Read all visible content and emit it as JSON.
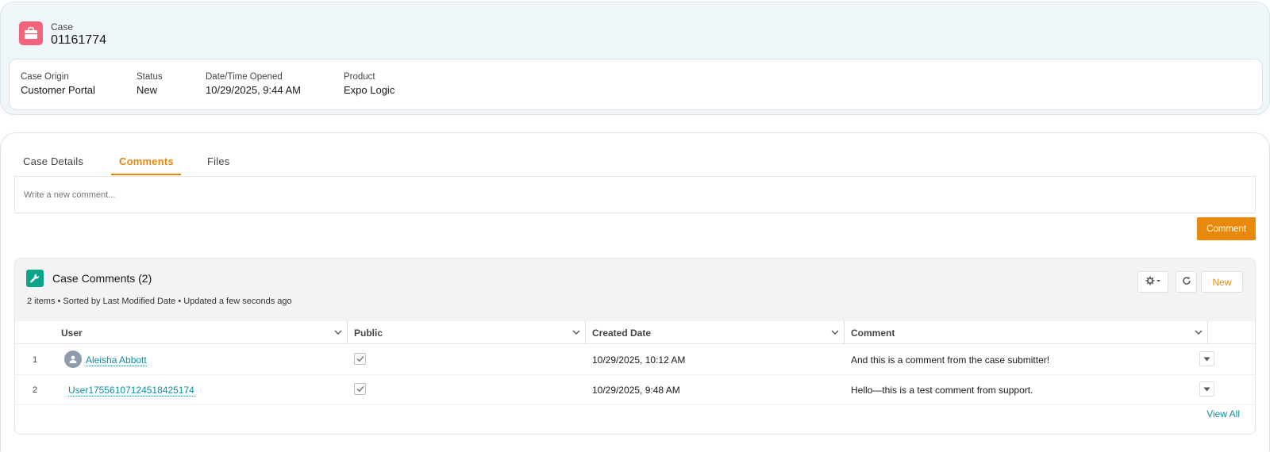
{
  "header": {
    "object_label": "Case",
    "case_number": "01161774",
    "fields": [
      {
        "label": "Case Origin",
        "value": "Customer Portal"
      },
      {
        "label": "Status",
        "value": "New"
      },
      {
        "label": "Date/Time Opened",
        "value": "10/29/2025, 9:44 AM"
      },
      {
        "label": "Product",
        "value": "Expo Logic"
      }
    ],
    "icon": "briefcase-icon",
    "icon_color": "#f2637c"
  },
  "tabs": [
    {
      "label": "Case Details"
    },
    {
      "label": "Comments",
      "active": true
    },
    {
      "label": "Files"
    }
  ],
  "composer": {
    "placeholder": "Write a new comment...",
    "submit_label": "Comment",
    "accent": "#e8890c"
  },
  "related_list": {
    "title": "Case Comments (2)",
    "meta": "2 items • Sorted by Last Modified Date • Updated a few seconds ago",
    "new_label": "New",
    "icon": "wrench-icon",
    "icon_color": "#0aa48a",
    "columns": [
      "User",
      "Public",
      "Created Date",
      "Comment"
    ],
    "rows": [
      {
        "num": "1",
        "user": "Aleisha Abbott",
        "public": true,
        "created": "10/29/2025, 10:12 AM",
        "comment": "And this is a comment from the case submitter!"
      },
      {
        "num": "2",
        "user": "User17556107124518425174",
        "public": true,
        "created": "10/29/2025, 9:48 AM",
        "comment": "Hello—this is a test comment from support."
      }
    ],
    "view_all_label": "View All"
  }
}
